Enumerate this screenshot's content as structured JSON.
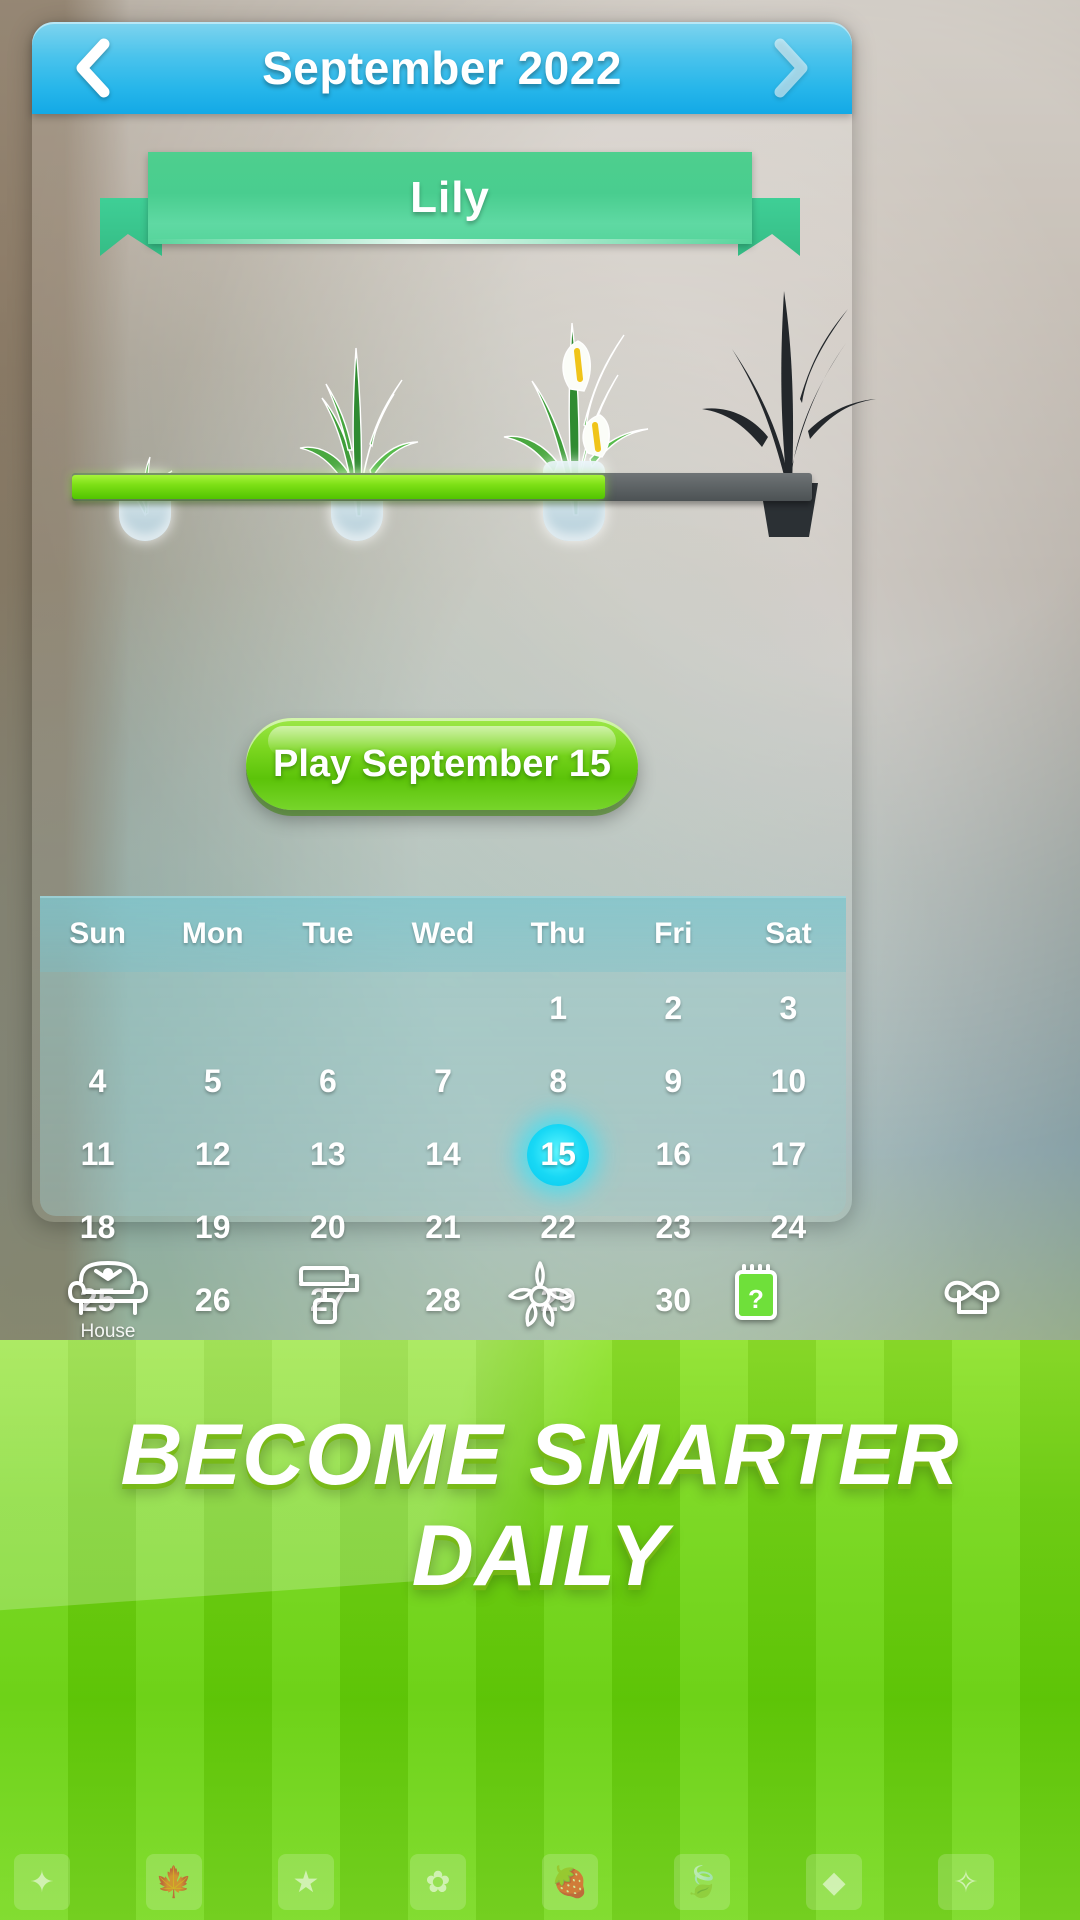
{
  "header": {
    "title": "September 2022",
    "prev_icon": "chevron-left-icon",
    "next_icon": "chevron-right-icon"
  },
  "banner": {
    "plant_name": "Lily"
  },
  "progress": {
    "percent": 72,
    "stages": 4,
    "completed_stages": 3
  },
  "play_button": {
    "label": "Play September 15"
  },
  "calendar": {
    "weekdays": [
      "Sun",
      "Mon",
      "Tue",
      "Wed",
      "Thu",
      "Fri",
      "Sat"
    ],
    "selected_day": 15,
    "weeks": [
      [
        "",
        "",
        "",
        "",
        "1",
        "2",
        "3"
      ],
      [
        "4",
        "5",
        "6",
        "7",
        "8",
        "9",
        "10"
      ],
      [
        "11",
        "12",
        "13",
        "14",
        "15",
        "16",
        "17"
      ],
      [
        "18",
        "19",
        "20",
        "21",
        "22",
        "23",
        "24"
      ],
      [
        "25",
        "26",
        "27",
        "28",
        "29",
        "30",
        ""
      ]
    ]
  },
  "bottom_nav": {
    "items": [
      {
        "icon": "armchair-icon",
        "label": "House"
      },
      {
        "icon": "paint-roller-icon",
        "label": ""
      },
      {
        "icon": "lotus-flower-icon",
        "label": ""
      },
      {
        "icon": "calendar-question-icon",
        "label": ""
      },
      {
        "icon": "bow-ribbon-icon",
        "label": ""
      }
    ],
    "active_index": 3
  },
  "ad": {
    "line1": "BECOME SMARTER",
    "line2": "DAILY",
    "tiles": [
      "✦",
      "🍁",
      "★",
      "✿",
      "🍓",
      "🍃",
      "◆",
      "✧"
    ]
  },
  "colors": {
    "header_blue": "#27b6ea",
    "ribbon_green": "#4ecf8e",
    "progress_green": "#7ee016",
    "play_green": "#7ad61f",
    "selected_cyan": "#18d8f5",
    "calendar_teal": "#96cdcd",
    "ad_green": "#74d616"
  }
}
